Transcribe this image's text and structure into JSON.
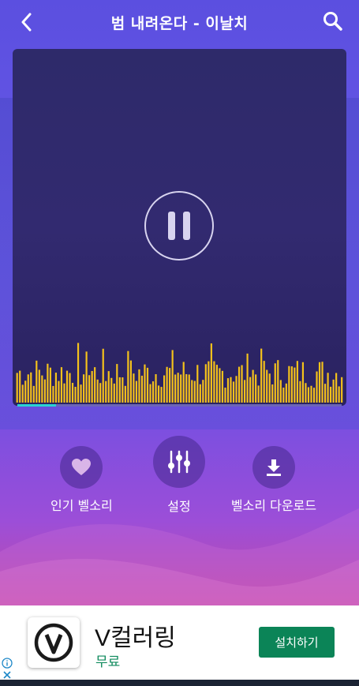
{
  "header": {
    "title": "범 내려온다 - 이날치",
    "back_icon": "chevron-left-icon",
    "search_icon": "search-icon"
  },
  "player": {
    "state": "playing",
    "control_icon": "pause-icon",
    "progress_fraction": 0.12,
    "visualizer_color": "#f5c21b",
    "progress_color": "#29d3d3"
  },
  "actions": [
    {
      "label": "인기 벨소리",
      "icon": "heart-icon"
    },
    {
      "label": "설정",
      "icon": "sliders-icon"
    },
    {
      "label": "벨소리 다운로드",
      "icon": "download-icon"
    }
  ],
  "ad": {
    "app_name": "V컬러링",
    "price": "무료",
    "install_label": "설치하기",
    "logo_icon": "v-logo-icon",
    "install_color": "#0b8457"
  }
}
